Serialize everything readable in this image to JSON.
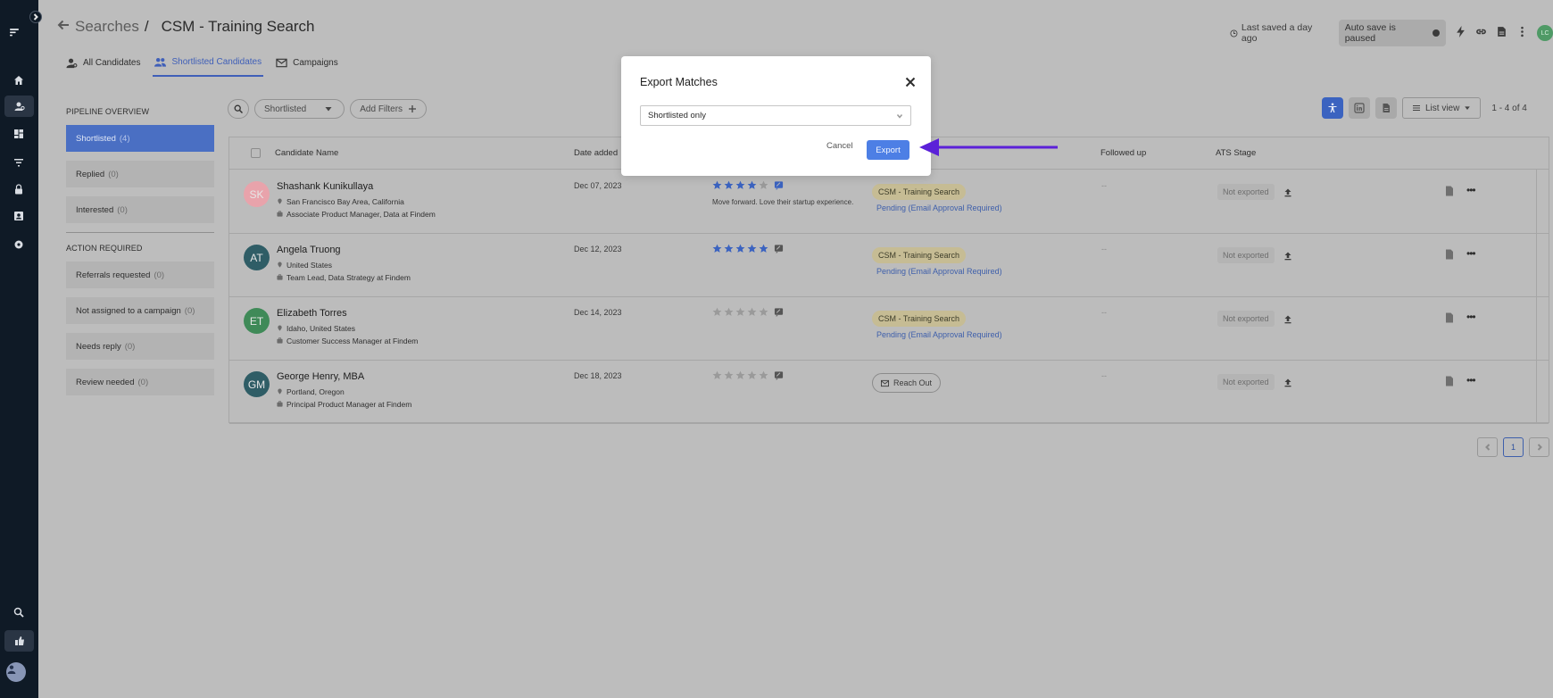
{
  "header": {
    "crumb": "Searches",
    "separator": "/",
    "title": "CSM - Training Search",
    "last_saved": "Last saved a day ago",
    "autosave": "Auto save is paused",
    "user_initials": "LC"
  },
  "tabs": [
    {
      "label": "All Candidates"
    },
    {
      "label": "Shortlisted Candidates"
    },
    {
      "label": "Campaigns"
    }
  ],
  "pipeline": {
    "heading": "PIPELINE OVERVIEW",
    "items": [
      {
        "label": "Shortlisted",
        "count": "(4)"
      },
      {
        "label": "Replied",
        "count": "(0)"
      },
      {
        "label": "Interested",
        "count": "(0)"
      }
    ]
  },
  "action_required": {
    "heading": "ACTION REQUIRED",
    "items": [
      {
        "label": "Referrals requested",
        "count": "(0)"
      },
      {
        "label": "Not assigned to a campaign",
        "count": "(0)"
      },
      {
        "label": "Needs reply",
        "count": "(0)"
      },
      {
        "label": "Review needed",
        "count": "(0)"
      }
    ]
  },
  "toolbar": {
    "filter_label": "Shortlisted",
    "add_filters": "Add Filters",
    "list_view": "List view",
    "range": "1 - 4 of 4"
  },
  "table": {
    "columns": {
      "name": "Candidate Name",
      "date": "Date added",
      "followed": "Followed up",
      "ats": "ATS Stage"
    },
    "rows": [
      {
        "initials": "SK",
        "avatar_color": "#e8a3ab",
        "name": "Shashank Kunikullaya",
        "location": "San Francisco Bay Area, California",
        "role": "Associate Product Manager, Data at Findem",
        "date": "Dec 07, 2023",
        "rating": 4,
        "note": "Move forward. Love their startup experience.",
        "campaign": "CSM - Training Search",
        "status": "Pending (Email Approval Required)",
        "followed": "--",
        "ats": "Not exported"
      },
      {
        "initials": "AT",
        "avatar_color": "#2f5d66",
        "name": "Angela Truong",
        "location": "United States",
        "role": "Team Lead, Data Strategy at Findem",
        "date": "Dec 12, 2023",
        "rating": 5,
        "note": "",
        "campaign": "CSM - Training Search",
        "status": "Pending (Email Approval Required)",
        "followed": "--",
        "ats": "Not exported"
      },
      {
        "initials": "ET",
        "avatar_color": "#3f8a58",
        "name": "Elizabeth Torres",
        "location": "Idaho, United States",
        "role": "Customer Success Manager at Findem",
        "date": "Dec 14, 2023",
        "rating": 0,
        "note": "",
        "campaign": "CSM - Training Search",
        "status": "Pending (Email Approval Required)",
        "followed": "--",
        "ats": "Not exported"
      },
      {
        "initials": "GM",
        "avatar_color": "#2f5d66",
        "name": "George Henry, MBA",
        "location": "Portland, Oregon",
        "role": "Principal Product Manager at Findem",
        "date": "Dec 18, 2023",
        "rating": 0,
        "note": "",
        "campaign": "",
        "status": "",
        "reach_out": "Reach Out",
        "followed": "--",
        "ats": "Not exported"
      }
    ]
  },
  "pagination": {
    "current": "1"
  },
  "modal": {
    "title": "Export Matches",
    "select_value": "Shortlisted only",
    "cancel": "Cancel",
    "export": "Export"
  },
  "colors": {
    "accent": "#4a6fc3",
    "star": "#3b63c0",
    "arrow": "#5b21d8",
    "export_button": "#4d7fe5"
  }
}
